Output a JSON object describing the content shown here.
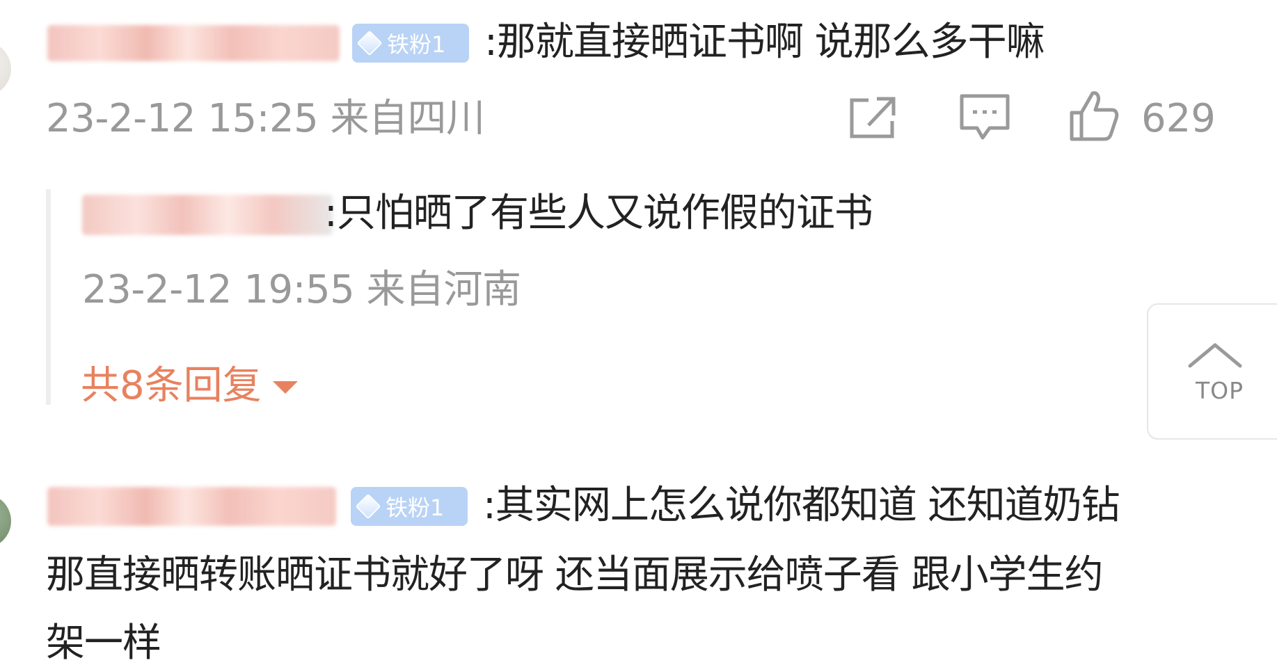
{
  "comments": [
    {
      "badge": "铁粉1",
      "text": ":那就直接晒证书啊 说那么多干嘛",
      "meta": "23-2-12 15:25 来自四川",
      "likes": "629",
      "replies": [
        {
          "text": ":只怕晒了有些人又说作假的证书",
          "meta": "23-2-12 19:55 来自河南"
        }
      ],
      "reply_count_label": "共8条回复"
    },
    {
      "badge": "铁粉1",
      "text_lines": [
        ":其实网上怎么说你都知道 还知道奶钻",
        "那直接晒转账晒证书就好了呀 还当面展示给喷子看 跟小学生约",
        "架一样"
      ]
    }
  ],
  "top_button": {
    "label": "TOP"
  },
  "icons": {
    "share": "share-icon",
    "comment": "comment-icon",
    "like": "thumbs-up-icon",
    "top": "chevron-up-icon",
    "badge": "diamond-icon"
  },
  "colors": {
    "reply_count": "#e8825e",
    "badge_bg": "#b9d3f6",
    "meta_text": "#999999",
    "body_text": "#222222"
  }
}
